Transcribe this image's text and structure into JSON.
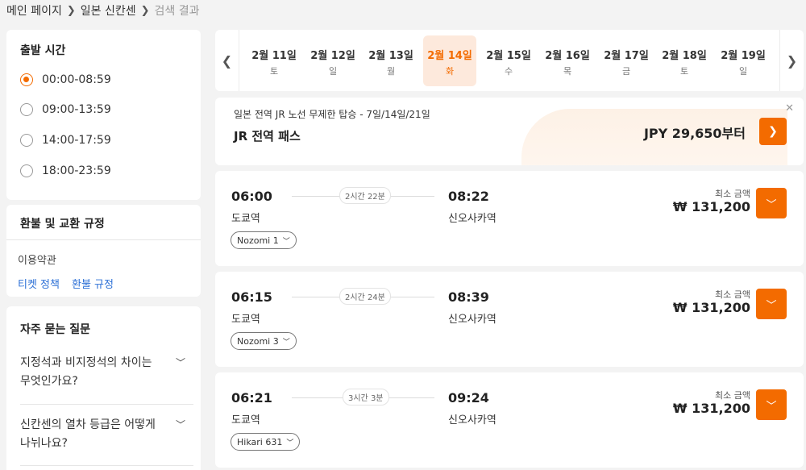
{
  "breadcrumb": {
    "home": "메인 페이지",
    "section": "일본 신칸센",
    "current": "검색 결과"
  },
  "sidebar": {
    "departure": {
      "title": "출발 시간",
      "options": [
        {
          "label": "00:00-08:59",
          "checked": true
        },
        {
          "label": "09:00-13:59",
          "checked": false
        },
        {
          "label": "14:00-17:59",
          "checked": false
        },
        {
          "label": "18:00-23:59",
          "checked": false
        }
      ]
    },
    "refund": {
      "title": "환불 및 교환 규정",
      "terms_label": "이용약관",
      "ticket_policy": "티켓 정책",
      "refund_policy": "환불 규정"
    },
    "faq": {
      "title": "자주 묻는 질문",
      "items": [
        {
          "question": "지정석과 비지정석의 차이는 무엇인가요?"
        },
        {
          "question": "신칸센의 열차 등급은 어떻게 나뉘나요?"
        }
      ]
    }
  },
  "dates": [
    {
      "date": "2월 11일",
      "weekday": "토",
      "active": false
    },
    {
      "date": "2월 12일",
      "weekday": "일",
      "active": false
    },
    {
      "date": "2월 13일",
      "weekday": "월",
      "active": false
    },
    {
      "date": "2월 14일",
      "weekday": "화",
      "active": true
    },
    {
      "date": "2월 15일",
      "weekday": "수",
      "active": false
    },
    {
      "date": "2월 16일",
      "weekday": "목",
      "active": false
    },
    {
      "date": "2월 17일",
      "weekday": "금",
      "active": false
    },
    {
      "date": "2월 18일",
      "weekday": "토",
      "active": false
    },
    {
      "date": "2월 19일",
      "weekday": "일",
      "active": false
    }
  ],
  "banner": {
    "subtitle": "일본 전역 JR 노선 무제한 탑승 - 7일/14일/21일",
    "title": "JR 전역 패스",
    "price": "JPY 29,650부터"
  },
  "trains": [
    {
      "dep_time": "06:00",
      "arr_time": "08:22",
      "duration": "2시간 22분",
      "dep_station": "도쿄역",
      "arr_station": "신오사카역",
      "train_name": "Nozomi 1",
      "min_price_label": "최소 금액",
      "price": "₩ 131,200"
    },
    {
      "dep_time": "06:15",
      "arr_time": "08:39",
      "duration": "2시간 24분",
      "dep_station": "도쿄역",
      "arr_station": "신오사카역",
      "train_name": "Nozomi 3",
      "min_price_label": "최소 금액",
      "price": "₩ 131,200"
    },
    {
      "dep_time": "06:21",
      "arr_time": "09:24",
      "duration": "3시간 3분",
      "dep_station": "도쿄역",
      "arr_station": "신오사카역",
      "train_name": "Hikari 631",
      "min_price_label": "최소 금액",
      "price": "₩ 131,200"
    }
  ],
  "colors": {
    "accent": "#f36b00",
    "link": "#2b6fd6"
  }
}
